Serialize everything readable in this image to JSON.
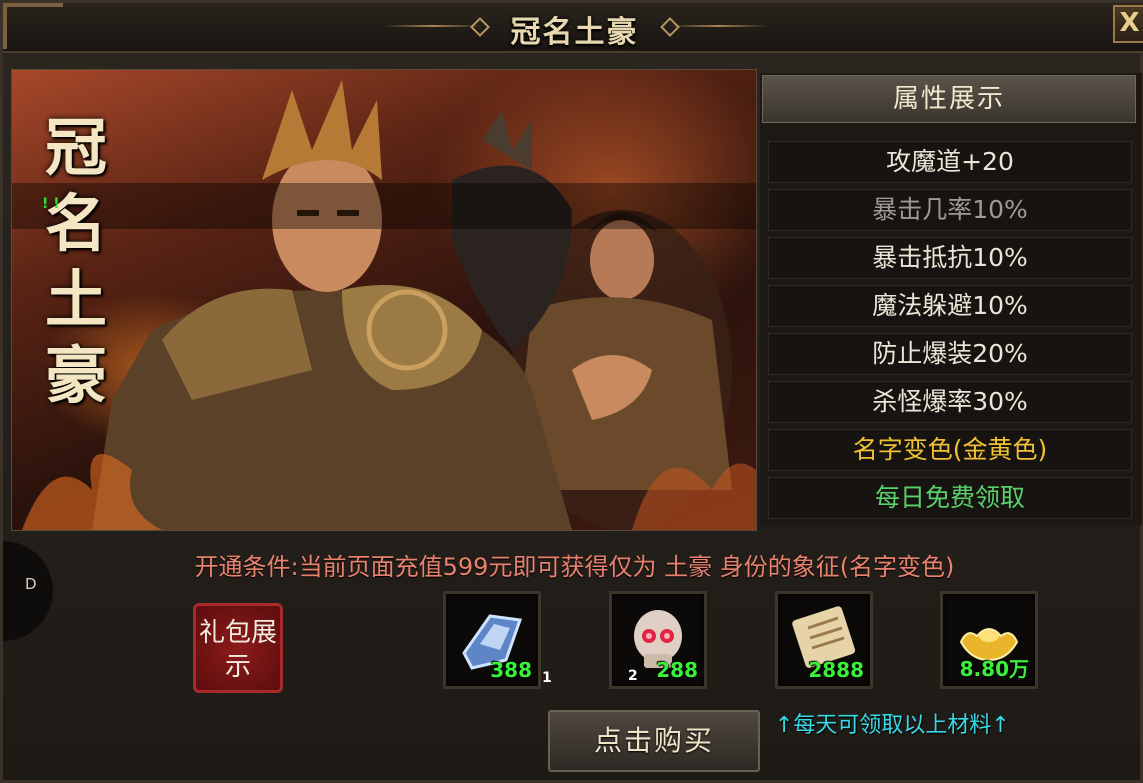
{
  "window": {
    "title": "冠名土豪",
    "close_label": "X"
  },
  "hero": {
    "calligraphy": "冠名土豪",
    "marker": "! !"
  },
  "attributes": {
    "header": "属性展示",
    "items": [
      {
        "text": "攻魔道+20",
        "color": "#ece5d7"
      },
      {
        "text": "暴击几率10%",
        "color": "#9e9a92"
      },
      {
        "text": "暴击抵抗10%",
        "color": "#ece5d7"
      },
      {
        "text": "魔法躲避10%",
        "color": "#ece5d7"
      },
      {
        "text": "防止爆装20%",
        "color": "#ece5d7"
      },
      {
        "text": "杀怪爆率30%",
        "color": "#ece5d7"
      },
      {
        "text": "名字变色(金黄色)",
        "color": "#f0c233"
      },
      {
        "text": "每日免费领取",
        "color": "#5ad06a"
      }
    ]
  },
  "condition_text": "开通条件:当前页面充值599元即可获得仅为 土豪 身份的象征(名字变色)",
  "side_tab_label": "D",
  "gift_label": "礼包展示",
  "rewards": [
    {
      "icon": "crystal-icon",
      "count": "388",
      "badge": "1"
    },
    {
      "icon": "skull-icon",
      "count": "288",
      "badge": "2"
    },
    {
      "icon": "scroll-icon",
      "count": "2888",
      "badge": ""
    },
    {
      "icon": "gold-ingot-icon",
      "count": "8.80万",
      "badge": ""
    }
  ],
  "buy_button": "点击购买",
  "daily_note": "↑每天可领取以上材料↑"
}
